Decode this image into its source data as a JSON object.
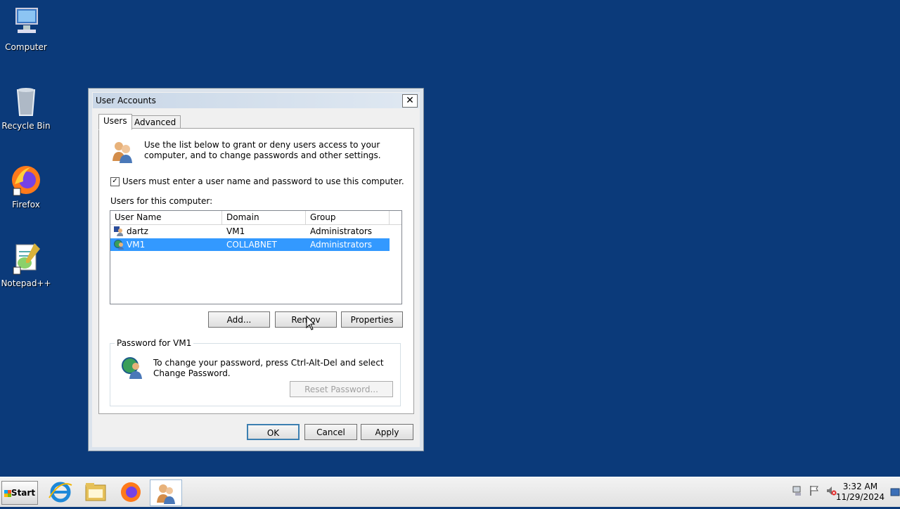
{
  "desktop": {
    "icons": [
      {
        "label": "Computer"
      },
      {
        "label": "Recycle Bin"
      },
      {
        "label": "Firefox"
      },
      {
        "label": "Notepad++"
      }
    ]
  },
  "window": {
    "title": "User Accounts",
    "close_glyph": "✕",
    "tabs": [
      "Users",
      "Advanced"
    ],
    "intro_text": "Use the list below to grant or deny users access to your computer, and to change passwords and other settings.",
    "require_login_label": "Users must enter a user name and password to use this computer.",
    "require_login_checked": true,
    "users_label": "Users for this computer:",
    "columns": [
      "User Name",
      "Domain",
      "Group"
    ],
    "users": [
      {
        "name": "dartz",
        "domain": "VM1",
        "group": "Administrators",
        "selected": false
      },
      {
        "name": "VM1",
        "domain": "COLLABNET",
        "group": "Administrators",
        "selected": true
      }
    ],
    "buttons": {
      "add": "Add...",
      "remove": "Remov",
      "properties": "Properties"
    },
    "password_group_title": "Password for VM1",
    "password_text": "To change your password, press Ctrl-Alt-Del and select Change Password.",
    "reset_password": "Reset Password...",
    "ok": "OK",
    "cancel": "Cancel",
    "apply": "Apply"
  },
  "taskbar": {
    "start_label": "Start",
    "pinned": [
      "internet-explorer-icon",
      "explorer-folder-icon",
      "firefox-icon",
      "user-accounts-icon"
    ],
    "time": "3:32 AM",
    "date": "11/29/2024"
  }
}
